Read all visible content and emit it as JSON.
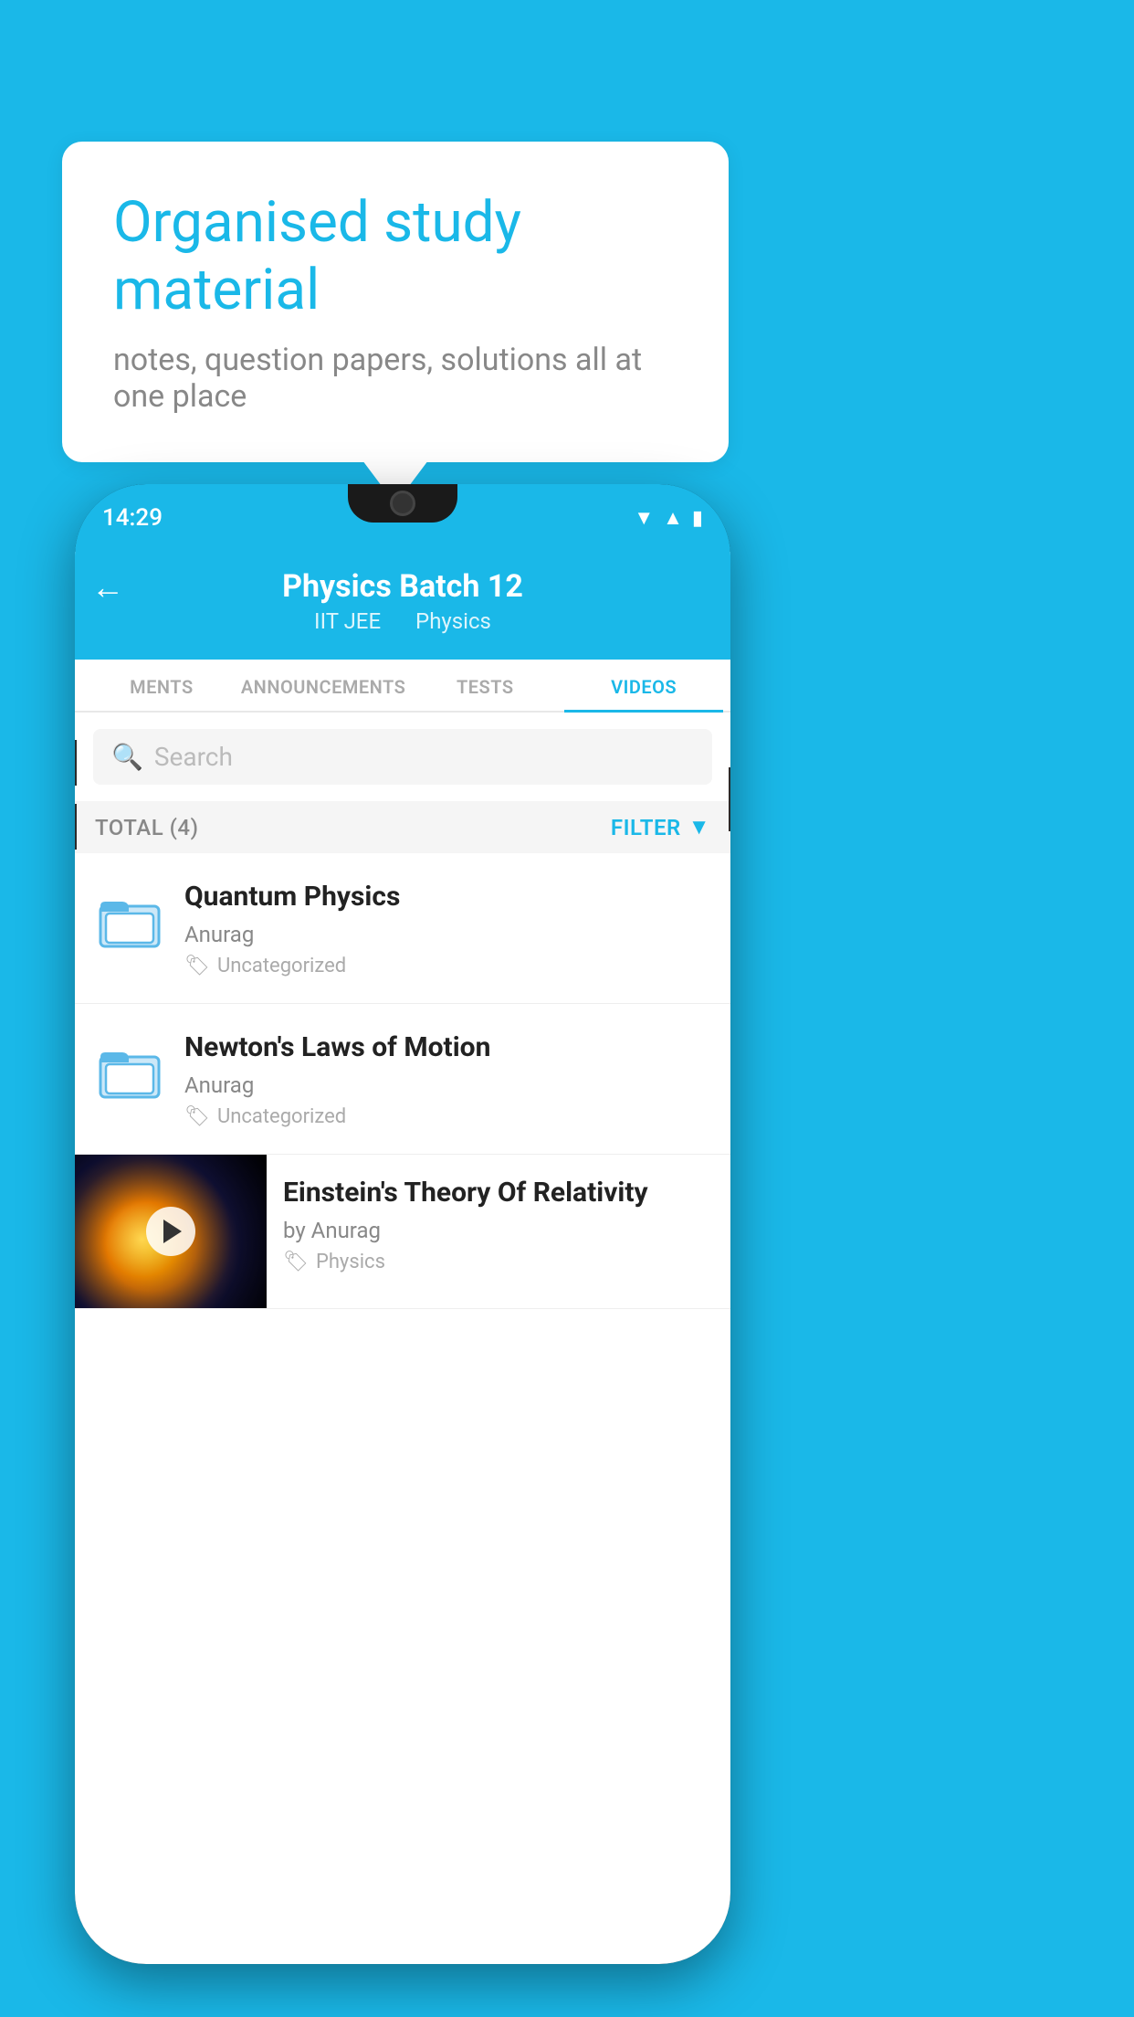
{
  "background": {
    "color": "#1ab8e8"
  },
  "speech_bubble": {
    "title": "Organised study material",
    "subtitle": "notes, question papers, solutions all at one place"
  },
  "phone": {
    "status_bar": {
      "time": "14:29"
    },
    "header": {
      "back_label": "←",
      "title": "Physics Batch 12",
      "subtitle_part1": "IIT JEE",
      "subtitle_part2": "Physics"
    },
    "tabs": [
      {
        "label": "MENTS",
        "active": false
      },
      {
        "label": "ANNOUNCEMENTS",
        "active": false
      },
      {
        "label": "TESTS",
        "active": false
      },
      {
        "label": "VIDEOS",
        "active": true
      }
    ],
    "search": {
      "placeholder": "Search"
    },
    "filter_row": {
      "total_label": "TOTAL (4)",
      "filter_label": "FILTER"
    },
    "videos": [
      {
        "title": "Quantum Physics",
        "author": "Anurag",
        "tag": "Uncategorized",
        "has_thumbnail": false
      },
      {
        "title": "Newton's Laws of Motion",
        "author": "Anurag",
        "tag": "Uncategorized",
        "has_thumbnail": false
      },
      {
        "title": "Einstein's Theory Of Relativity",
        "author": "by Anurag",
        "tag": "Physics",
        "has_thumbnail": true
      }
    ]
  }
}
